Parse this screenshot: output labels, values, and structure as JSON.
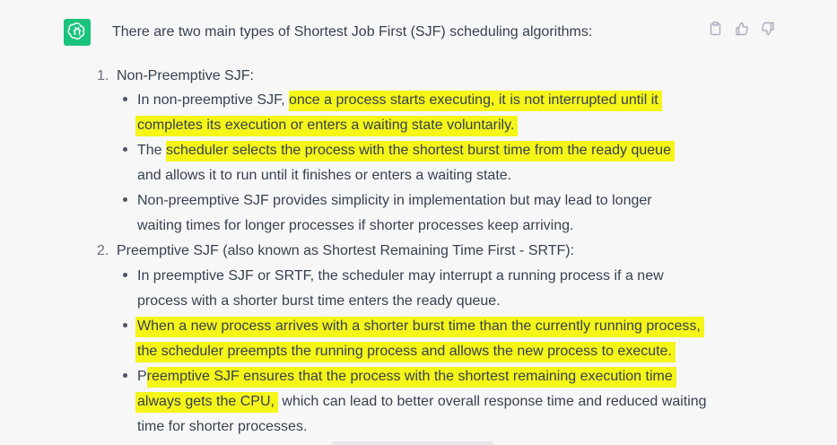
{
  "colors": {
    "background": "#f7f7f8",
    "text": "#374151",
    "avatar": "#19c37d",
    "highlight": "#f5f518"
  },
  "icons": {
    "avatar": "openai-logo-icon",
    "copy": "clipboard-icon",
    "like": "thumbs-up-icon",
    "dislike": "thumbs-down-icon"
  },
  "message": {
    "intro": "There are two main types of Shortest Job First (SJF) scheduling algorithms:",
    "items": [
      {
        "number": "1.",
        "title": "Non-Preemptive SJF:",
        "bullets": [
          {
            "l1_pre": "In non-preemptive SJF, ",
            "l1_hl": "once a process starts executing, it is not interrupted until it",
            "l2_hl": "completes its execution or enters a waiting state voluntarily."
          },
          {
            "l1_pre": "The ",
            "l1_hl": "scheduler selects the process with the shortest burst time from the ready queue",
            "l2": "and allows it to run until it finishes or enters a waiting state."
          },
          {
            "l1": "Non-preemptive SJF provides simplicity in implementation but may lead to longer",
            "l2": "waiting times for longer processes if shorter processes keep arriving."
          }
        ]
      },
      {
        "number": "2.",
        "title": "Preemptive SJF (also known as Shortest Remaining Time First - SRTF):",
        "bullets": [
          {
            "l1": "In preemptive SJF or SRTF, the scheduler may interrupt a running process if a new",
            "l2": "process with a shorter burst time enters the ready queue."
          },
          {
            "l1_hl": "When a new process arrives with a shorter burst time than the currently running process,",
            "l2_hl": "the scheduler preempts the running process and allows the new process to execute."
          },
          {
            "l1_pre": "P",
            "l1_hl": "reemptive SJF ensures that the process with the shortest remaining execution time",
            "l2_hl": "always gets the CPU,",
            "l2_post": " which can lead to better overall response time and reduced waiting",
            "l3": "time for shorter processes."
          }
        ]
      }
    ]
  }
}
